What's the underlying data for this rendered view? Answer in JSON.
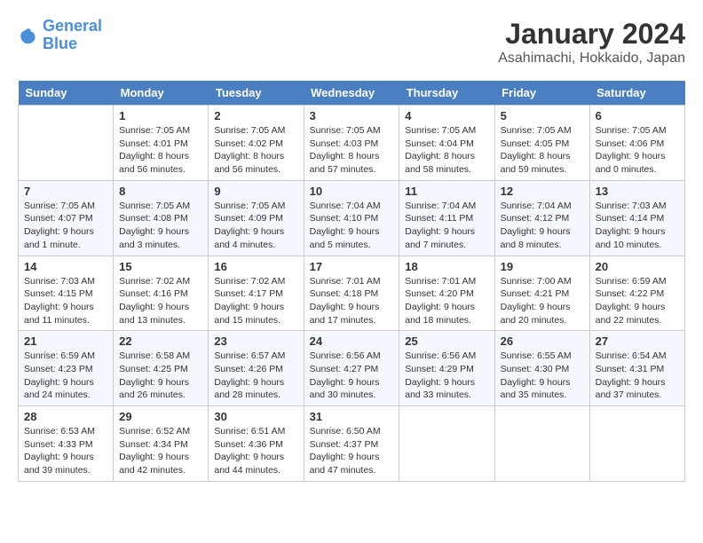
{
  "header": {
    "logo_line1": "General",
    "logo_line2": "Blue",
    "month": "January 2024",
    "location": "Asahimachi, Hokkaido, Japan"
  },
  "days_of_week": [
    "Sunday",
    "Monday",
    "Tuesday",
    "Wednesday",
    "Thursday",
    "Friday",
    "Saturday"
  ],
  "weeks": [
    [
      {
        "num": "",
        "sunrise": "",
        "sunset": "",
        "daylight": ""
      },
      {
        "num": "1",
        "sunrise": "Sunrise: 7:05 AM",
        "sunset": "Sunset: 4:01 PM",
        "daylight": "Daylight: 8 hours and 56 minutes."
      },
      {
        "num": "2",
        "sunrise": "Sunrise: 7:05 AM",
        "sunset": "Sunset: 4:02 PM",
        "daylight": "Daylight: 8 hours and 56 minutes."
      },
      {
        "num": "3",
        "sunrise": "Sunrise: 7:05 AM",
        "sunset": "Sunset: 4:03 PM",
        "daylight": "Daylight: 8 hours and 57 minutes."
      },
      {
        "num": "4",
        "sunrise": "Sunrise: 7:05 AM",
        "sunset": "Sunset: 4:04 PM",
        "daylight": "Daylight: 8 hours and 58 minutes."
      },
      {
        "num": "5",
        "sunrise": "Sunrise: 7:05 AM",
        "sunset": "Sunset: 4:05 PM",
        "daylight": "Daylight: 8 hours and 59 minutes."
      },
      {
        "num": "6",
        "sunrise": "Sunrise: 7:05 AM",
        "sunset": "Sunset: 4:06 PM",
        "daylight": "Daylight: 9 hours and 0 minutes."
      }
    ],
    [
      {
        "num": "7",
        "sunrise": "Sunrise: 7:05 AM",
        "sunset": "Sunset: 4:07 PM",
        "daylight": "Daylight: 9 hours and 1 minute."
      },
      {
        "num": "8",
        "sunrise": "Sunrise: 7:05 AM",
        "sunset": "Sunset: 4:08 PM",
        "daylight": "Daylight: 9 hours and 3 minutes."
      },
      {
        "num": "9",
        "sunrise": "Sunrise: 7:05 AM",
        "sunset": "Sunset: 4:09 PM",
        "daylight": "Daylight: 9 hours and 4 minutes."
      },
      {
        "num": "10",
        "sunrise": "Sunrise: 7:04 AM",
        "sunset": "Sunset: 4:10 PM",
        "daylight": "Daylight: 9 hours and 5 minutes."
      },
      {
        "num": "11",
        "sunrise": "Sunrise: 7:04 AM",
        "sunset": "Sunset: 4:11 PM",
        "daylight": "Daylight: 9 hours and 7 minutes."
      },
      {
        "num": "12",
        "sunrise": "Sunrise: 7:04 AM",
        "sunset": "Sunset: 4:12 PM",
        "daylight": "Daylight: 9 hours and 8 minutes."
      },
      {
        "num": "13",
        "sunrise": "Sunrise: 7:03 AM",
        "sunset": "Sunset: 4:14 PM",
        "daylight": "Daylight: 9 hours and 10 minutes."
      }
    ],
    [
      {
        "num": "14",
        "sunrise": "Sunrise: 7:03 AM",
        "sunset": "Sunset: 4:15 PM",
        "daylight": "Daylight: 9 hours and 11 minutes."
      },
      {
        "num": "15",
        "sunrise": "Sunrise: 7:02 AM",
        "sunset": "Sunset: 4:16 PM",
        "daylight": "Daylight: 9 hours and 13 minutes."
      },
      {
        "num": "16",
        "sunrise": "Sunrise: 7:02 AM",
        "sunset": "Sunset: 4:17 PM",
        "daylight": "Daylight: 9 hours and 15 minutes."
      },
      {
        "num": "17",
        "sunrise": "Sunrise: 7:01 AM",
        "sunset": "Sunset: 4:18 PM",
        "daylight": "Daylight: 9 hours and 17 minutes."
      },
      {
        "num": "18",
        "sunrise": "Sunrise: 7:01 AM",
        "sunset": "Sunset: 4:20 PM",
        "daylight": "Daylight: 9 hours and 18 minutes."
      },
      {
        "num": "19",
        "sunrise": "Sunrise: 7:00 AM",
        "sunset": "Sunset: 4:21 PM",
        "daylight": "Daylight: 9 hours and 20 minutes."
      },
      {
        "num": "20",
        "sunrise": "Sunrise: 6:59 AM",
        "sunset": "Sunset: 4:22 PM",
        "daylight": "Daylight: 9 hours and 22 minutes."
      }
    ],
    [
      {
        "num": "21",
        "sunrise": "Sunrise: 6:59 AM",
        "sunset": "Sunset: 4:23 PM",
        "daylight": "Daylight: 9 hours and 24 minutes."
      },
      {
        "num": "22",
        "sunrise": "Sunrise: 6:58 AM",
        "sunset": "Sunset: 4:25 PM",
        "daylight": "Daylight: 9 hours and 26 minutes."
      },
      {
        "num": "23",
        "sunrise": "Sunrise: 6:57 AM",
        "sunset": "Sunset: 4:26 PM",
        "daylight": "Daylight: 9 hours and 28 minutes."
      },
      {
        "num": "24",
        "sunrise": "Sunrise: 6:56 AM",
        "sunset": "Sunset: 4:27 PM",
        "daylight": "Daylight: 9 hours and 30 minutes."
      },
      {
        "num": "25",
        "sunrise": "Sunrise: 6:56 AM",
        "sunset": "Sunset: 4:29 PM",
        "daylight": "Daylight: 9 hours and 33 minutes."
      },
      {
        "num": "26",
        "sunrise": "Sunrise: 6:55 AM",
        "sunset": "Sunset: 4:30 PM",
        "daylight": "Daylight: 9 hours and 35 minutes."
      },
      {
        "num": "27",
        "sunrise": "Sunrise: 6:54 AM",
        "sunset": "Sunset: 4:31 PM",
        "daylight": "Daylight: 9 hours and 37 minutes."
      }
    ],
    [
      {
        "num": "28",
        "sunrise": "Sunrise: 6:53 AM",
        "sunset": "Sunset: 4:33 PM",
        "daylight": "Daylight: 9 hours and 39 minutes."
      },
      {
        "num": "29",
        "sunrise": "Sunrise: 6:52 AM",
        "sunset": "Sunset: 4:34 PM",
        "daylight": "Daylight: 9 hours and 42 minutes."
      },
      {
        "num": "30",
        "sunrise": "Sunrise: 6:51 AM",
        "sunset": "Sunset: 4:36 PM",
        "daylight": "Daylight: 9 hours and 44 minutes."
      },
      {
        "num": "31",
        "sunrise": "Sunrise: 6:50 AM",
        "sunset": "Sunset: 4:37 PM",
        "daylight": "Daylight: 9 hours and 47 minutes."
      },
      {
        "num": "",
        "sunrise": "",
        "sunset": "",
        "daylight": ""
      },
      {
        "num": "",
        "sunrise": "",
        "sunset": "",
        "daylight": ""
      },
      {
        "num": "",
        "sunrise": "",
        "sunset": "",
        "daylight": ""
      }
    ]
  ]
}
